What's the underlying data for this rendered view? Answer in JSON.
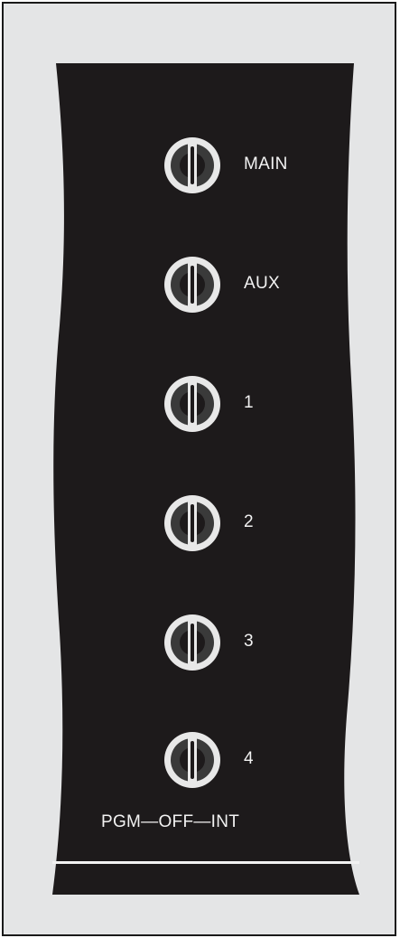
{
  "panel": {
    "background_color": "#e4e5e6",
    "faceplate_color": "#1d1a1b",
    "knob_ring_color": "#e8e8e8",
    "knob_dark_color": "#3a3a3a",
    "text_color": "#f2f2f2"
  },
  "switches": [
    {
      "label": "MAIN",
      "icon": "rotary-knob-icon"
    },
    {
      "label": "AUX",
      "icon": "rotary-knob-icon"
    },
    {
      "label": "1",
      "icon": "rotary-knob-icon"
    },
    {
      "label": "2",
      "icon": "rotary-knob-icon"
    },
    {
      "label": "3",
      "icon": "rotary-knob-icon"
    },
    {
      "label": "4",
      "icon": "rotary-knob-icon"
    }
  ],
  "legend": {
    "text": "PGM—OFF—INT"
  }
}
